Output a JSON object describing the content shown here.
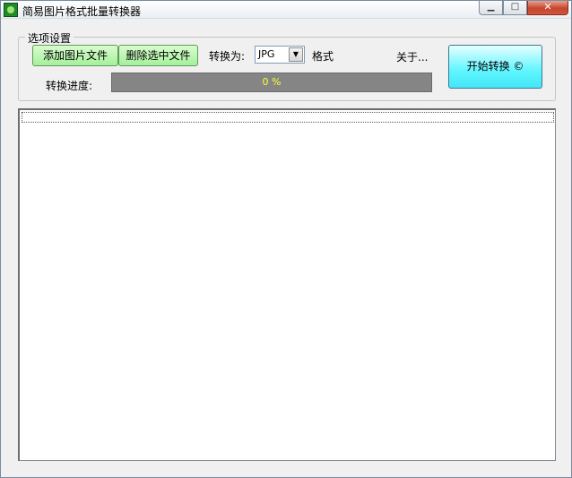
{
  "window": {
    "title": "简易图片格式批量转换器",
    "min_symbol": "▁",
    "max_symbol": "□",
    "close_symbol": "✕"
  },
  "options": {
    "group_label": "选项设置",
    "add_button": "添加图片文件",
    "delete_button": "删除选中文件",
    "convert_to_label": "转换为:",
    "format_selected": "JPG",
    "format_suffix": "格式",
    "about_label": "关于...",
    "start_button": "开始转换 ©",
    "progress_label": "转换进度:",
    "progress_text": "0 %",
    "progress_value": 0
  },
  "file_list": {
    "items": []
  },
  "colors": {
    "green_button": "#a5f09a",
    "start_button": "#5ff5ff",
    "progress_bg": "#858585",
    "progress_text": "#ffff33"
  }
}
